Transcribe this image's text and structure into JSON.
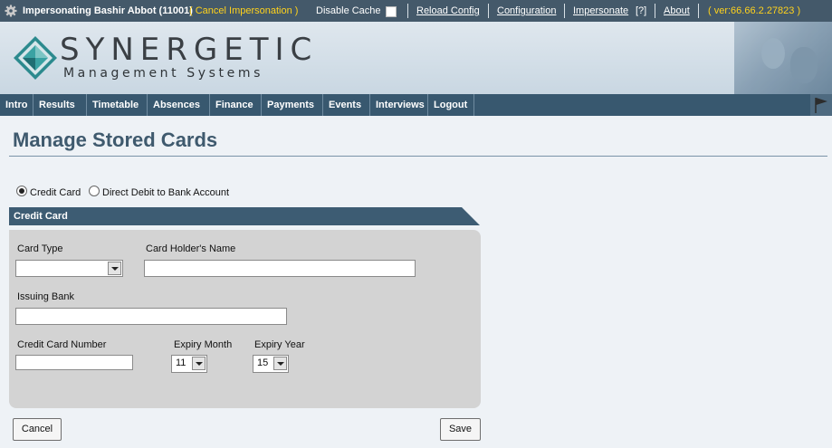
{
  "admin_bar": {
    "impersonating": "Impersonating Bashir Abbot (11001)",
    "cancel": "( Cancel Impersonation )",
    "disable_cache": "Disable Cache",
    "links": {
      "reload": "Reload Config",
      "configuration": "Configuration",
      "impersonate": "Impersonate",
      "help": "[?]",
      "about": "About"
    },
    "version": "( ver:66.66.2.27823 )",
    "colors": {
      "bar": "#44596a",
      "highlight": "#ffd21c"
    }
  },
  "logo": {
    "word": "SYNERGETIC",
    "sub": "Management Systems"
  },
  "nav": {
    "items": [
      "Intro",
      "Results",
      "Timetable",
      "Absences",
      "Finance",
      "Payments",
      "Events",
      "Interviews",
      "Logout"
    ]
  },
  "page": {
    "title": "Manage Stored Cards"
  },
  "payment_type": {
    "options": [
      "Credit Card",
      "Direct Debit to Bank Account"
    ],
    "selected": "Credit Card"
  },
  "section": {
    "title": "Credit Card"
  },
  "form": {
    "card_type": {
      "label": "Card Type",
      "value": ""
    },
    "holder_name": {
      "label": "Card Holder's Name",
      "value": ""
    },
    "issuing_bank": {
      "label": "Issuing Bank",
      "value": ""
    },
    "card_number": {
      "label": "Credit Card Number",
      "value": ""
    },
    "expiry_month": {
      "label": "Expiry Month",
      "value": "11"
    },
    "expiry_year": {
      "label": "Expiry Year",
      "value": "15"
    }
  },
  "buttons": {
    "cancel": "Cancel",
    "save": "Save"
  },
  "icons": [
    "gear-icon",
    "synergetic-logo",
    "flag-icon",
    "dropdown-arrow-icon"
  ]
}
